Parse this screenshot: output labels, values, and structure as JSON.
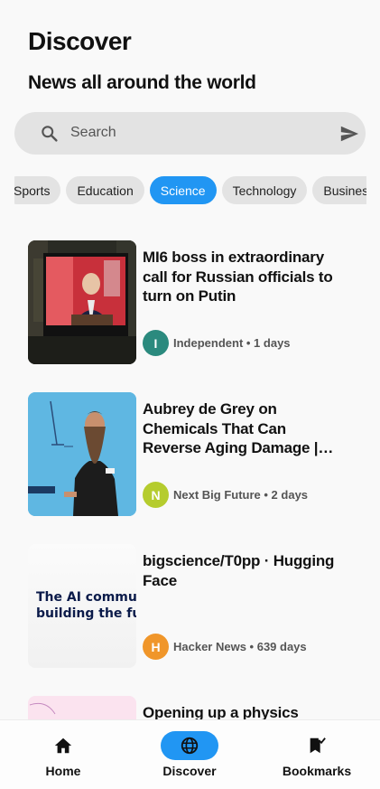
{
  "header": {
    "title": "Discover",
    "subtitle": "News all around the world"
  },
  "search": {
    "placeholder": "Search",
    "icon": "search-icon",
    "send_icon": "send-icon"
  },
  "categories": [
    {
      "label": "Sports",
      "active": false
    },
    {
      "label": "Education",
      "active": false
    },
    {
      "label": "Science",
      "active": true
    },
    {
      "label": "Technology",
      "active": false
    },
    {
      "label": "Business",
      "active": false
    }
  ],
  "articles": [
    {
      "title": "MI6 boss in extraordinary call for Russian officials to turn on Putin",
      "avatar_letter": "I",
      "avatar_color": "#2b8a7e",
      "source": "Independent • 1 days",
      "thumb_text": ""
    },
    {
      "title": "Aubrey de Grey on Chemicals That Can Reverse Aging Damage | NextBigFuture.com",
      "avatar_letter": "N",
      "avatar_color": "#b5cc2e",
      "source": "Next Big Future • 2 days",
      "thumb_text": ""
    },
    {
      "title": "bigscience/T0pp · Hugging Face",
      "avatar_letter": "H",
      "avatar_color": "#f0962a",
      "source": "Hacker News • 639 days",
      "thumb_text": "The AI community building the future"
    },
    {
      "title": "Opening up a physics",
      "avatar_letter": "",
      "avatar_color": "#888888",
      "source": "",
      "thumb_text": ""
    }
  ],
  "nav": {
    "items": [
      {
        "label": "Home",
        "icon": "home-icon",
        "active": false
      },
      {
        "label": "Discover",
        "icon": "globe-icon",
        "active": true
      },
      {
        "label": "Bookmarks",
        "icon": "bookmark-check-icon",
        "active": false
      }
    ]
  },
  "colors": {
    "accent": "#2196f3",
    "chip_bg": "#e3e3e3",
    "background": "#f9f9f9"
  }
}
